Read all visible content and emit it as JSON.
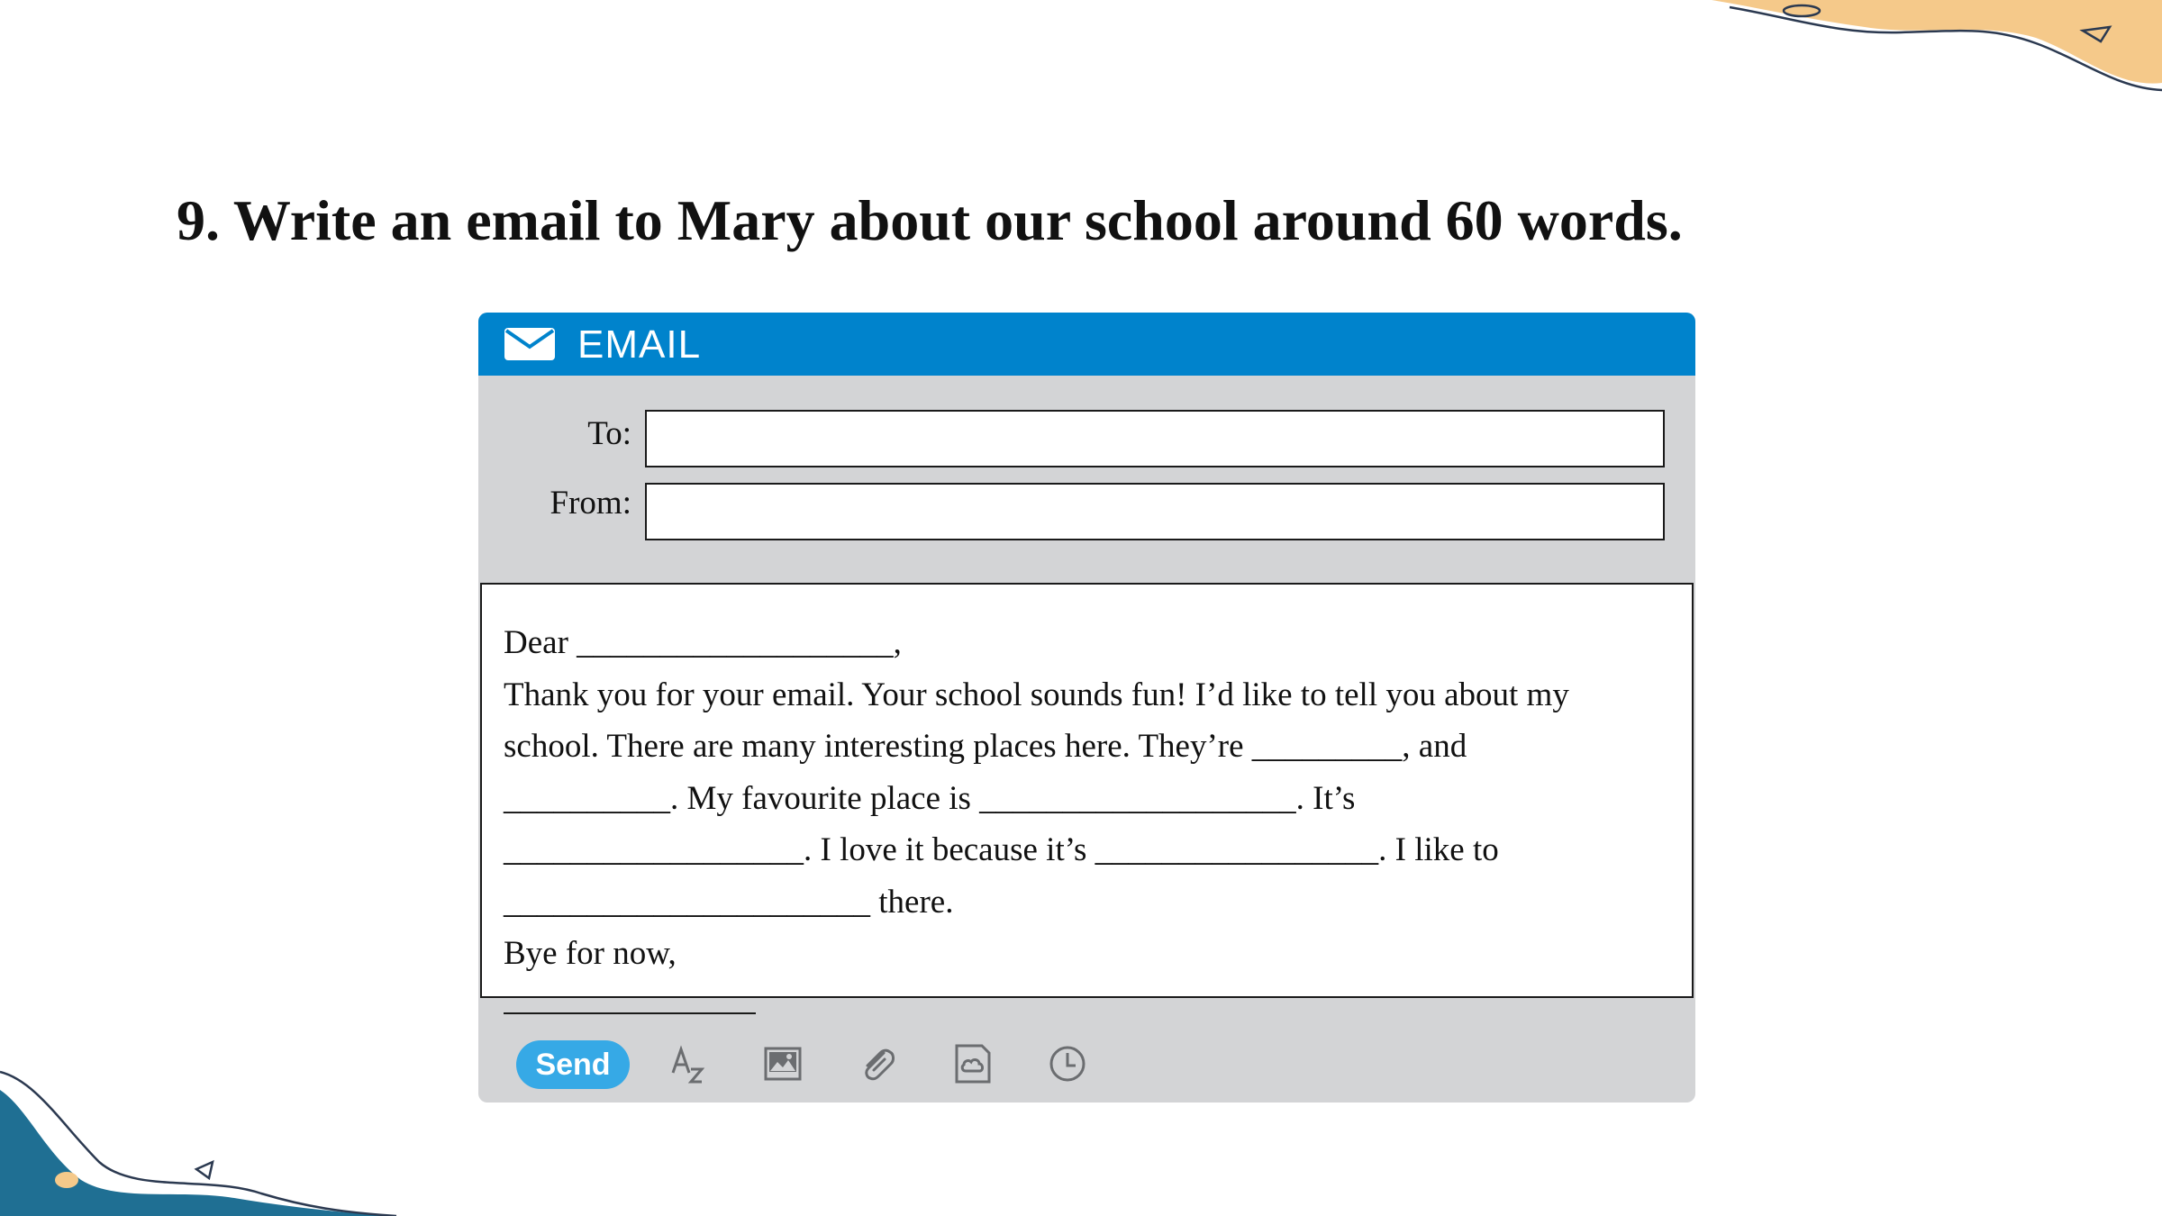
{
  "page": {
    "title": "9. Write an email to Mary about our school around 60 words."
  },
  "email": {
    "header_title": "EMAIL",
    "to_label": "To:",
    "to_value": "",
    "from_label": "From:",
    "from_value": "",
    "body_lines": [
      "Dear ___________________,",
      "Thank you for your email. Your school sounds fun! I’d like to tell you about my",
      "school. There are many interesting places here. They’re _________, and",
      "__________. My favourite place is ___________________. It’s",
      "__________________. I love it because it’s _________________. I like to",
      "______________________ there.",
      "Bye for now,"
    ],
    "send_label": "Send",
    "toolbar_icons": [
      "font-format-icon",
      "image-icon",
      "attachment-icon",
      "cloud-file-icon",
      "clock-icon"
    ]
  },
  "colors": {
    "header_blue": "#0083cc",
    "send_blue": "#36a9e6",
    "panel_gray": "#d3d4d6",
    "accent_orange": "#f5c98a",
    "accent_teal": "#1f6f93"
  }
}
